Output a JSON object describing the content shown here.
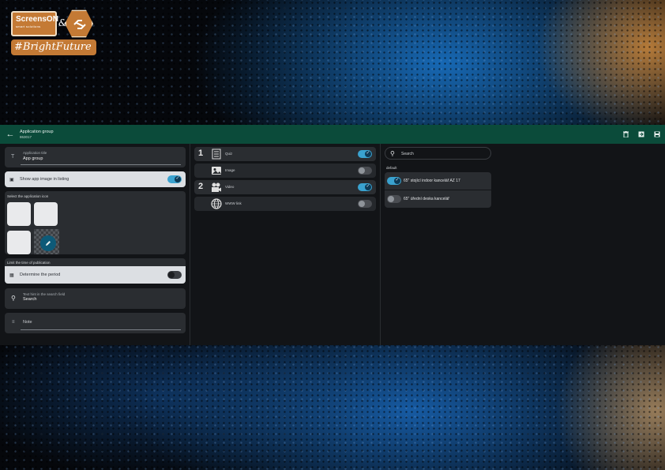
{
  "branding": {
    "company": "ScreensON",
    "company_sub": "smart solutions",
    "amp": "&",
    "hashtag": "#BrightFuture",
    "brand_color": "#c47a35"
  },
  "topbar": {
    "title": "Application group",
    "subtitle": "863017",
    "color": "#0b4b3a",
    "actions": [
      "trash-icon",
      "export-icon",
      "save-icon"
    ]
  },
  "left": {
    "title_field": {
      "label": "Application title",
      "value": "App group",
      "icon": "text-icon"
    },
    "show_image": {
      "label": "Show app image in listing",
      "on": true
    },
    "icon_section": {
      "header": "Select the application icon"
    },
    "publication": {
      "header": "Limit the time of publication",
      "label": "Determine the period",
      "on": false
    },
    "search_hint": {
      "label": "Text hint in the search field",
      "value": "Search"
    },
    "note": {
      "placeholder": "Note"
    }
  },
  "apps": [
    {
      "number": "1",
      "icon": "quiz-icon",
      "name": "Quiz",
      "on": true
    },
    {
      "number": "",
      "icon": "image-icon",
      "name": "Image",
      "on": false
    },
    {
      "number": "2",
      "icon": "video-icon",
      "name": "Video",
      "on": true
    },
    {
      "number": "",
      "icon": "www-icon",
      "name": "WWW link",
      "on": false
    }
  ],
  "right": {
    "search_placeholder": "Search",
    "group": "default",
    "devices": [
      {
        "name": "65\" stojící indoor kancelář AZ 17",
        "on": true
      },
      {
        "name": "65\" úřední deska kancelář",
        "on": false
      }
    ]
  },
  "colors": {
    "accent": "#3aa2cf",
    "panel": "#2a2d31",
    "background": "#121417"
  }
}
